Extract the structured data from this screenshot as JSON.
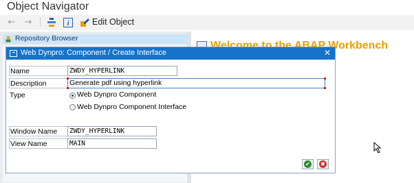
{
  "app": {
    "title": "Object Navigator"
  },
  "toolbar": {
    "back_icon": "back-arrow-icon",
    "forward_icon": "forward-arrow-icon",
    "hierarchy_icon": "hierarchy-icon",
    "info_icon": "info-icon",
    "info_glyph": "i",
    "edit_icon": "edit-object-icon",
    "edit_label": "Edit Object"
  },
  "navigator": {
    "repository_browser_label": "Repository Browser"
  },
  "workbench": {
    "welcome_text": "Welcome to the ABAP Workbench",
    "welcome_color": "#e8a000"
  },
  "dialog": {
    "title": "Web Dynpro: Component / Create Interface",
    "close_glyph": "✕",
    "header_color": "#1573c9",
    "fields": {
      "name_label": "Name",
      "name_value": "ZWDY_HYPERLINK",
      "description_label": "Description",
      "description_value": "Generate pdf using hyperlink",
      "type_label": "Type",
      "window_name_label": "Window Name",
      "window_name_value": "ZWDY_HYPERLINK",
      "view_name_label": "View Name",
      "view_name_value": "MAIN"
    },
    "type_options": [
      {
        "label": "Web Dynpro Component",
        "selected": true
      },
      {
        "label": "Web Dynpro Component Interface",
        "selected": false
      }
    ],
    "buttons": {
      "ok_icon": "check-icon",
      "ok_glyph": "✔",
      "cancel_icon": "cancel-icon",
      "cancel_glyph": "✖"
    }
  }
}
